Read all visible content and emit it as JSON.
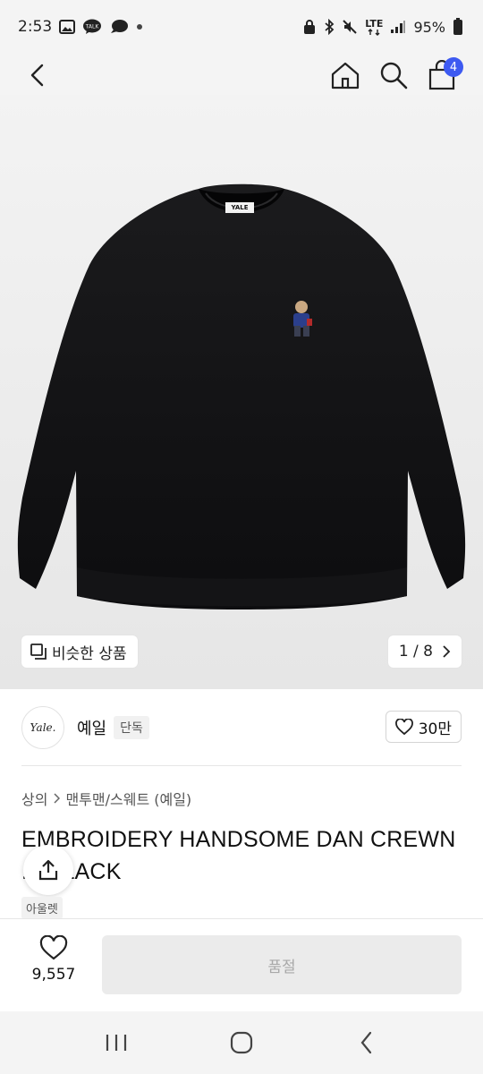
{
  "status_bar": {
    "time": "2:53",
    "talk_label": "TALK",
    "network_label": "LTE",
    "battery": "95%"
  },
  "header": {
    "cart_count": "4"
  },
  "gallery": {
    "neck_label": "YALE",
    "similar_label": "비슷한 상품",
    "pager": "1 / 8"
  },
  "brand": {
    "logo_text": "Yale.",
    "name": "예일",
    "badge": "단독",
    "likes": "30만"
  },
  "product": {
    "breadcrumb": [
      "상의",
      "맨투맨/스웨트 (예일)"
    ],
    "title": "EMBROIDERY HANDSOME DAN CREWN ... BLACK",
    "outlet": "아울렛"
  },
  "bottom_bar": {
    "wish_count": "9,557",
    "soldout_label": "품절"
  },
  "icons": {
    "back": "chevron-left-icon",
    "home": "home-icon",
    "search": "search-icon",
    "cart": "shopping-bag-icon",
    "share": "share-icon",
    "heart": "heart-icon"
  }
}
